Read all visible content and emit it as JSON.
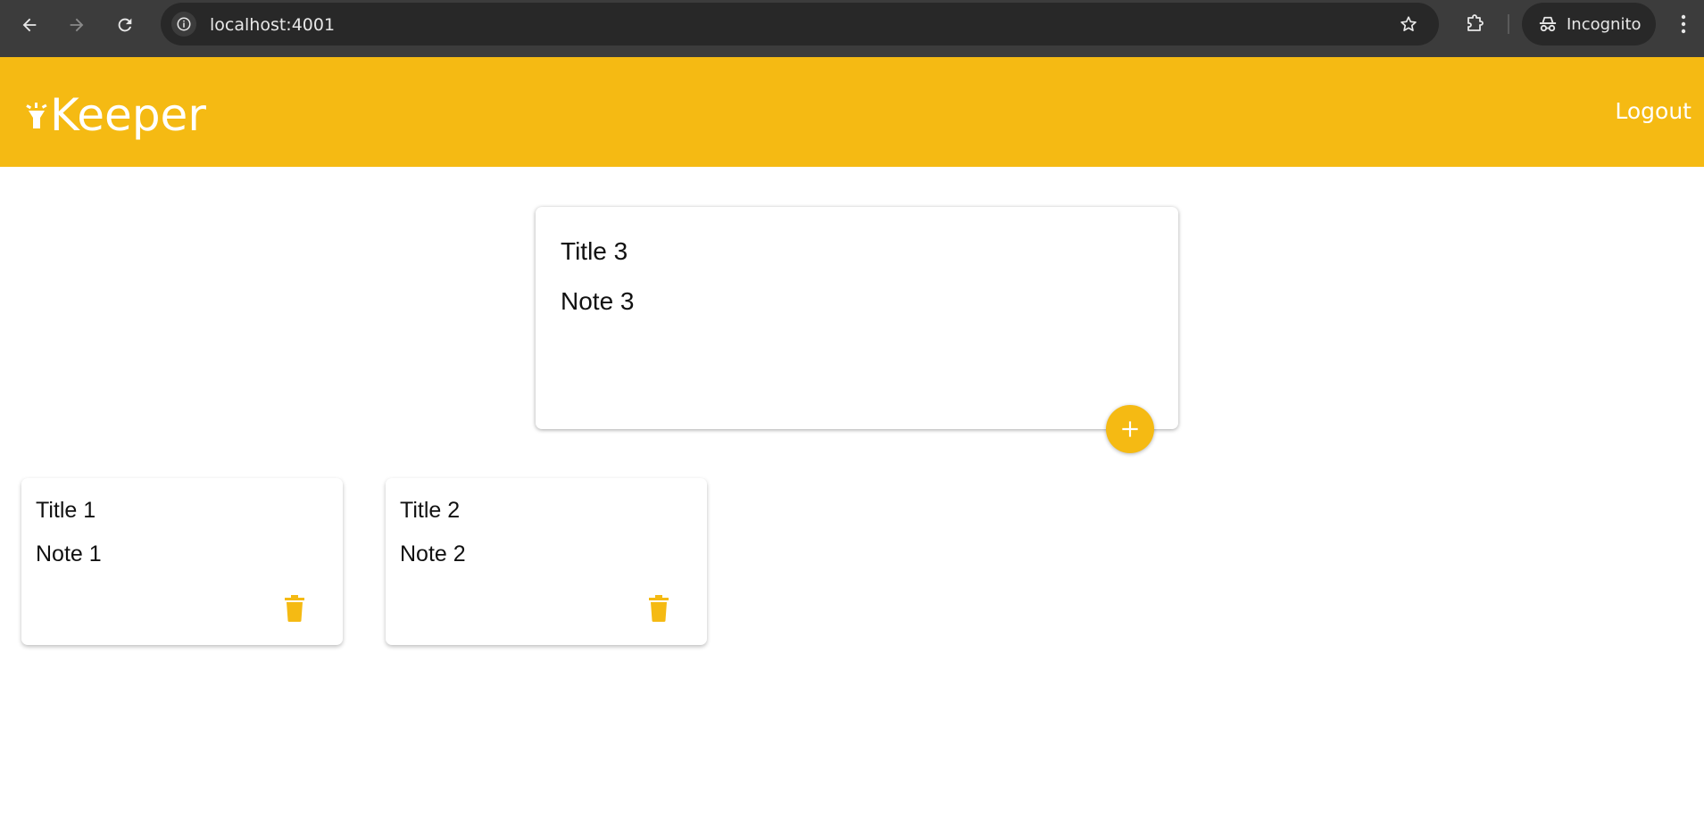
{
  "browser": {
    "url": "localhost:4001",
    "profile_label": "Incognito",
    "icons": [
      "back-icon",
      "forward-icon",
      "reload-icon",
      "site-info-icon",
      "bookmark-star-icon",
      "extensions-icon",
      "incognito-icon",
      "kebab-menu-icon"
    ]
  },
  "header": {
    "brand": "Keeper",
    "logout_label": "Logout",
    "accent_color": "#f5ba13"
  },
  "create_area": {
    "title_value": "Title 3",
    "content_value": "Note 3",
    "add_icon": "plus-icon"
  },
  "notes": [
    {
      "title": "Title 1",
      "content": "Note 1",
      "delete_icon": "trash-icon"
    },
    {
      "title": "Title 2",
      "content": "Note 2",
      "delete_icon": "trash-icon"
    }
  ]
}
